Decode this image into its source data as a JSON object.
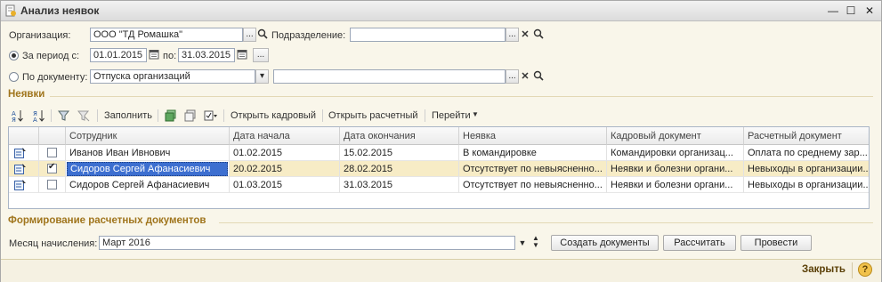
{
  "window": {
    "title": "Анализ неявок",
    "minimize": "—",
    "maximize": "☐",
    "close": "✕"
  },
  "filters": {
    "org_label": "Организация:",
    "org_value": "ООО \"ТД Ромашка\"",
    "dept_label": "Подразделение:",
    "dept_value": "",
    "period_label": "За период с:",
    "date_from": "01.01.2015",
    "to_label": "по:",
    "date_to": "31.03.2015",
    "bydoc_label": "По документу:",
    "doc_type": "Отпуска организаций",
    "doc_value": "",
    "ellipsis": "..."
  },
  "absences": {
    "section_title": "Неявки",
    "toolbar": {
      "fill": "Заполнить",
      "open_hr": "Открыть кадровый",
      "open_payroll": "Открыть расчетный",
      "goto": "Перейти"
    },
    "columns": [
      "Сотрудник",
      "Дата начала",
      "Дата окончания",
      "Неявка",
      "Кадровый документ",
      "Расчетный документ"
    ],
    "rows": [
      {
        "checked": false,
        "employee": "Иванов Иван Ивнович",
        "start": "01.02.2015",
        "end": "15.02.2015",
        "absence": "В командировке",
        "hr_doc": "Командировки организац...",
        "payroll_doc": "Оплата по среднему зар..."
      },
      {
        "checked": true,
        "employee": "Сидоров Сергей Афанасиевич",
        "start": "20.02.2015",
        "end": "28.02.2015",
        "absence": "Отсутствует по невыясненно...",
        "hr_doc": "Неявки и болезни органи...",
        "payroll_doc": "Невыходы в организации..."
      },
      {
        "checked": false,
        "employee": "Сидоров Сергей Афанасиевич",
        "start": "01.03.2015",
        "end": "31.03.2015",
        "absence": "Отсутствует по невыясненно...",
        "hr_doc": "Неявки и болезни органи...",
        "payroll_doc": "Невыходы в организации..."
      }
    ]
  },
  "payroll": {
    "section_title": "Формирование расчетных документов",
    "month_label": "Месяц начисления:",
    "month_value": "Март 2016",
    "create_button": "Создать документы",
    "calc_button": "Рассчитать",
    "post_button": "Провести"
  },
  "footer": {
    "close_button": "Закрыть",
    "help": "?"
  },
  "colors": {
    "section": "#a0751d",
    "selected_row": "#f7ecc6",
    "selected_cell": "#3d6fd0"
  }
}
